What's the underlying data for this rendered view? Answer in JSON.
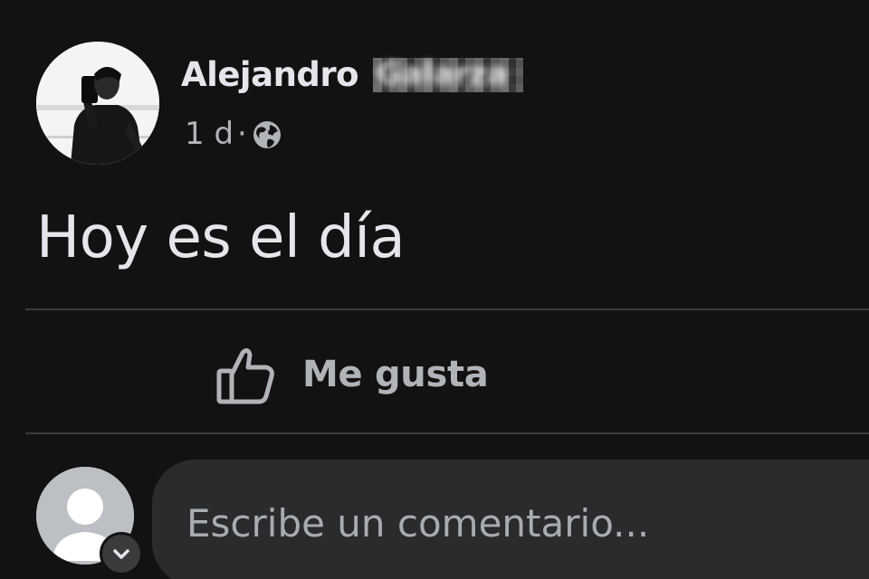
{
  "post": {
    "author_first_name": "Alejandro",
    "author_surname_redacted": "Galarza",
    "timestamp": "1 d",
    "separator": "·",
    "privacy_icon": "globe-icon",
    "text": "Hoy es el día"
  },
  "actions": {
    "like_label": "Me gusta",
    "like_icon": "thumbs-up-icon"
  },
  "comment": {
    "placeholder": "Escribe un comentario...",
    "value": ""
  },
  "colors": {
    "background": "#121213",
    "primary_text": "#e4e6eb",
    "secondary_text": "#b0b3b8",
    "divider": "#3a3b3c",
    "input_bg": "#2a2b2d"
  }
}
